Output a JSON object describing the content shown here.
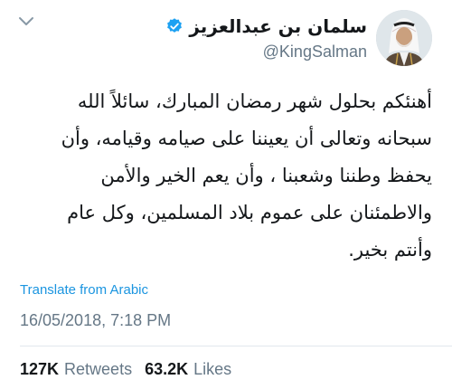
{
  "tweet": {
    "author": {
      "display_name": "سلمان بن عبدالعزيز",
      "handle": "@KingSalman",
      "verified": true,
      "verified_color": "#1da1f2",
      "avatar_icon": "avatar-portrait-icon"
    },
    "more_icon": "chevron-down-icon",
    "text": "أهنئكم بحلول شهر رمضان المبارك، سائلاً الله\nسبحانه وتعالى أن يعيننا على صيامه وقيامه، وأن\nيحفظ وطننا وشعبنا ، وأن يعم الخير والأمن\nوالاطمئنان على عموم بلاد المسلمين، وكل عام\nوأنتم بخير.",
    "translate_label": "Translate from Arabic",
    "timestamp": "16/05/2018, 7:18 PM",
    "stats": {
      "retweets_count": "127K",
      "retweets_label": "Retweets",
      "likes_count": "63.2K",
      "likes_label": "Likes"
    },
    "colors": {
      "link": "#1b95e0",
      "secondary_text": "#657786",
      "primary_text": "#14171a",
      "divider": "#e1e8ed"
    }
  }
}
